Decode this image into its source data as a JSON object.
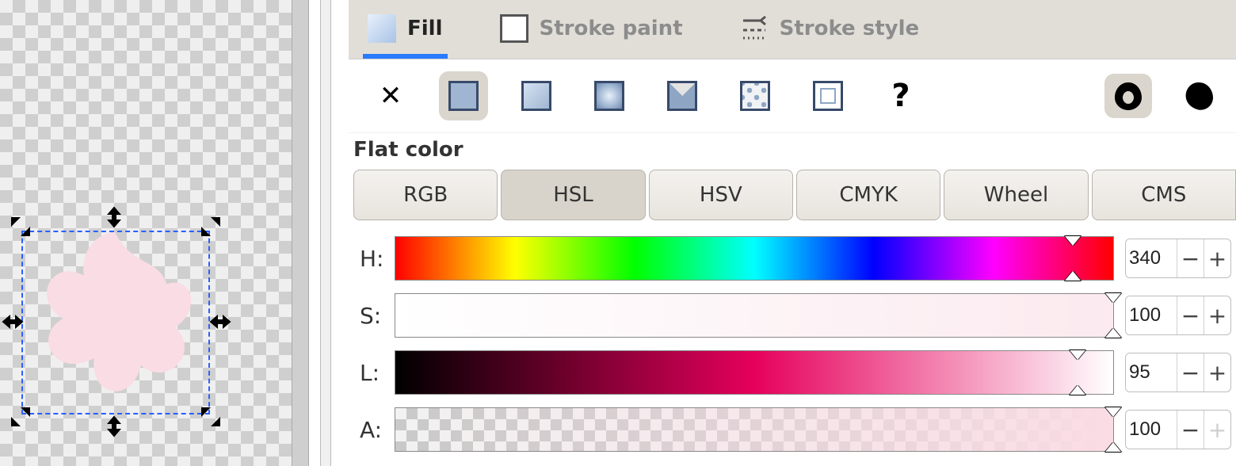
{
  "canvas": {
    "shape": "flower",
    "shape_fill": "#fadce4",
    "selection_visible": true
  },
  "tabs": {
    "fill": {
      "label": "Fill",
      "active": true
    },
    "strokePaint": {
      "label": "Stroke paint",
      "active": false
    },
    "strokeStyle": {
      "label": "Stroke style",
      "active": false
    }
  },
  "paintTypes": {
    "none": {
      "name": "no-paint",
      "glyph": "✕"
    },
    "flat": {
      "name": "flat-color",
      "selected": true
    },
    "linear": {
      "name": "linear-gradient"
    },
    "radial": {
      "name": "radial-gradient"
    },
    "pattern": {
      "name": "pattern"
    },
    "mesh": {
      "name": "mesh-gradient"
    },
    "swatch": {
      "name": "swatch"
    },
    "unknown": {
      "name": "unknown-paint",
      "glyph": "?"
    }
  },
  "section_label": "Flat color",
  "colorModes": {
    "rgb": {
      "label": "RGB",
      "active": false
    },
    "hsl": {
      "label": "HSL",
      "active": true
    },
    "hsv": {
      "label": "HSV",
      "active": false
    },
    "cmyk": {
      "label": "CMYK",
      "active": false
    },
    "wheel": {
      "label": "Wheel",
      "active": false
    },
    "cms": {
      "label": "CMS",
      "active": false
    }
  },
  "sliders": {
    "h": {
      "label": "H:",
      "value": "340",
      "pos_pct": 94.4
    },
    "s": {
      "label": "S:",
      "value": "100",
      "pos_pct": 100
    },
    "l": {
      "label": "L:",
      "value": "95",
      "pos_pct": 95
    },
    "a": {
      "label": "A:",
      "value": "100",
      "pos_pct": 100
    }
  },
  "colors": {
    "accent": "#2a7bff",
    "panel_bg": "#e1ded8",
    "button_bg": "#dad6ce",
    "slider_border": "#888888",
    "current_fill": "#fadce4"
  }
}
